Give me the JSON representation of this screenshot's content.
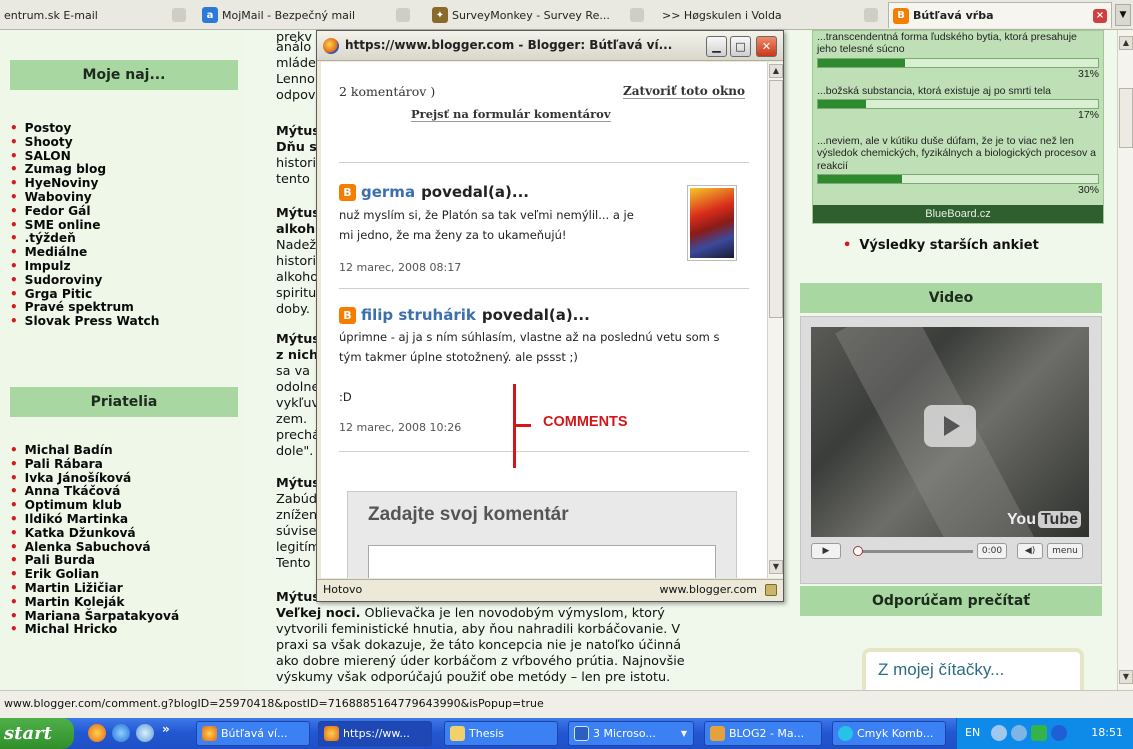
{
  "tabs": [
    {
      "label": "entrum.sk E-mail"
    },
    {
      "label": "MojMail - Bezpečný mail"
    },
    {
      "label": "SurveyMonkey - Survey Re..."
    },
    {
      "label": ">> Høgskulen i Volda"
    },
    {
      "label": "Bútľavá vŕba"
    }
  ],
  "left_sidebar": {
    "heading1": "Moje naj...",
    "links1": [
      "Postoy",
      "Shooty",
      "SALON",
      "Zumag blog",
      "HyeNoviny",
      "Waboviny",
      "Fedor Gál",
      "SME online",
      ".týždeň",
      "Mediálne",
      "Impulz",
      "Sudoroviny",
      "Grga Pitic",
      "Pravé spektrum",
      "Slovak Press Watch"
    ],
    "heading2": "Priatelia",
    "links2": [
      "Michal Badín",
      "Pali Rábara",
      "Ivka Jánošíková",
      "Anna Tkáčová",
      "Optimum klub",
      "Ildikó Martinka",
      "Katka Džunková",
      "Alenka Sabuchová",
      "Pali Burda",
      "Erik Golian",
      "Martin Ližičiar",
      "Martin Koleják",
      "Mariana Šarpatakyová",
      "Michal Hricko"
    ]
  },
  "article": {
    "frags": [
      {
        "text": "prekv",
        "bold": false
      },
      {
        "text": "análo",
        "bold": false
      },
      {
        "text": "mláde",
        "bold": false
      },
      {
        "text": "Lenno",
        "bold": false
      },
      {
        "text": "odpov",
        "bold": false
      },
      {
        "text": "Mýtus",
        "bold": true
      },
      {
        "text": "Dňu s",
        "bold": true
      },
      {
        "text": "histori",
        "bold": false
      },
      {
        "text": "tento",
        "bold": false
      },
      {
        "text": "Mýtus",
        "bold": true
      },
      {
        "text": "alkoh",
        "bold": true
      },
      {
        "text": "Nadež",
        "bold": false
      },
      {
        "text": "histori",
        "bold": false
      },
      {
        "text": "alkoho",
        "bold": false
      },
      {
        "text": "spiritu",
        "bold": false
      },
      {
        "text": "doby.",
        "bold": false
      },
      {
        "text": "Mýtus",
        "bold": true
      },
      {
        "text": "z nich",
        "bold": true
      },
      {
        "text": "sa va",
        "bold": false
      },
      {
        "text": "odolne",
        "bold": false
      },
      {
        "text": "vykľuv",
        "bold": false
      },
      {
        "text": "zem.",
        "bold": false
      },
      {
        "text": "prechá",
        "bold": false
      },
      {
        "text": "dole\".",
        "bold": false
      },
      {
        "text": "Mýtus",
        "bold": true
      },
      {
        "text": "Zabúd",
        "bold": false
      },
      {
        "text": "znížen",
        "bold": false
      },
      {
        "text": "súvise",
        "bold": false
      },
      {
        "text": "legitím",
        "bold": false
      },
      {
        "text": "Tento",
        "bold": false
      },
      {
        "text": "Mýtus",
        "bold": true
      }
    ],
    "tail_bold": "Veľkej noci.",
    "tail_lines": [
      " Oblievačka je len novodobým výmyslom, ktorý",
      "vytvorili feministické hnutia, aby ňou nahradili korbáčovanie. V",
      "praxi sa však dokazuje, že táto koncepcia nie je natoľko účinná",
      "ako dobre mierený úder korbáčom z vŕbového prútia. Najnovšie",
      "výskumy však odporúčajú použiť obe metódy – len pre istotu."
    ]
  },
  "poll": {
    "options": [
      {
        "text": "...transcendentná forma ľudského bytia, ktorá presahuje jeho telesné súcno",
        "percent": 31,
        "label": "31%"
      },
      {
        "text": "...božská substancia, ktorá existuje aj po smrti tela",
        "percent": 17,
        "label": "17%"
      },
      {
        "text": "...neviem, ale v kútiku duše dúfam, že je to viac než len výsledok chemických, fyzikálnych a biologických procesov a reakcií",
        "percent": 30,
        "label": "30%"
      }
    ],
    "provider": "BlueBoard.cz",
    "older_results": "Výsledky starších ankiet"
  },
  "video": {
    "heading": "Video",
    "logo": "You",
    "logo_tube": "Tube",
    "time": "0:00",
    "menu": "menu"
  },
  "reading": {
    "heading": "Odporúčam prečítať",
    "box_title": "Z mojej čítačky..."
  },
  "statusbar": {
    "url": "www.blogger.com/comment.g?blogID=25970418&postID=7168885164779643990&isPopup=true"
  },
  "popup": {
    "title": "https://www.blogger.com - Blogger: Bútľavá ví...",
    "count": "2 komentárov )",
    "close_link": "Zatvoriť toto okno",
    "form_link": "Prejsť na formulár komentárov",
    "comments": [
      {
        "author": "germa",
        "said": "povedal(a)...",
        "lines": [
          "nuž myslím si, že Platón sa tak veľmi nemýlil... a je",
          "mi jedno, že ma ženy za to ukameňujú!"
        ],
        "date": "12 marec, 2008 08:17"
      },
      {
        "author": "filip struhárik",
        "said": "povedal(a)...",
        "lines": [
          "úprimne - aj ja s ním súhlasím, vlastne až na poslednú vetu som s",
          "tým takmer úplne stotožnený. ale pssst ;)",
          "",
          ":D"
        ],
        "date": "12 marec, 2008 10:26"
      }
    ],
    "annotation": "COMMENTS",
    "form_title": "Zadajte svoj komentár",
    "status_left": "Hotovo",
    "status_right": "www.blogger.com"
  },
  "taskbar": {
    "start": "start",
    "buttons": [
      {
        "label": "Bútľavá ví..."
      },
      {
        "label": "https://ww..."
      },
      {
        "label": "Thesis"
      },
      {
        "label": "3 Microso..."
      },
      {
        "label": "BLOG2 - Ma..."
      },
      {
        "label": "Cmyk Komb..."
      }
    ],
    "lang": "EN",
    "clock": "18:51"
  },
  "colors": {
    "accent_green": "#a8d7a2",
    "link_red": "#d21d1d",
    "annotation_red": "#d4161b",
    "blogger_orange": "#f57d00",
    "taskbar_blue": "#2358d3"
  }
}
